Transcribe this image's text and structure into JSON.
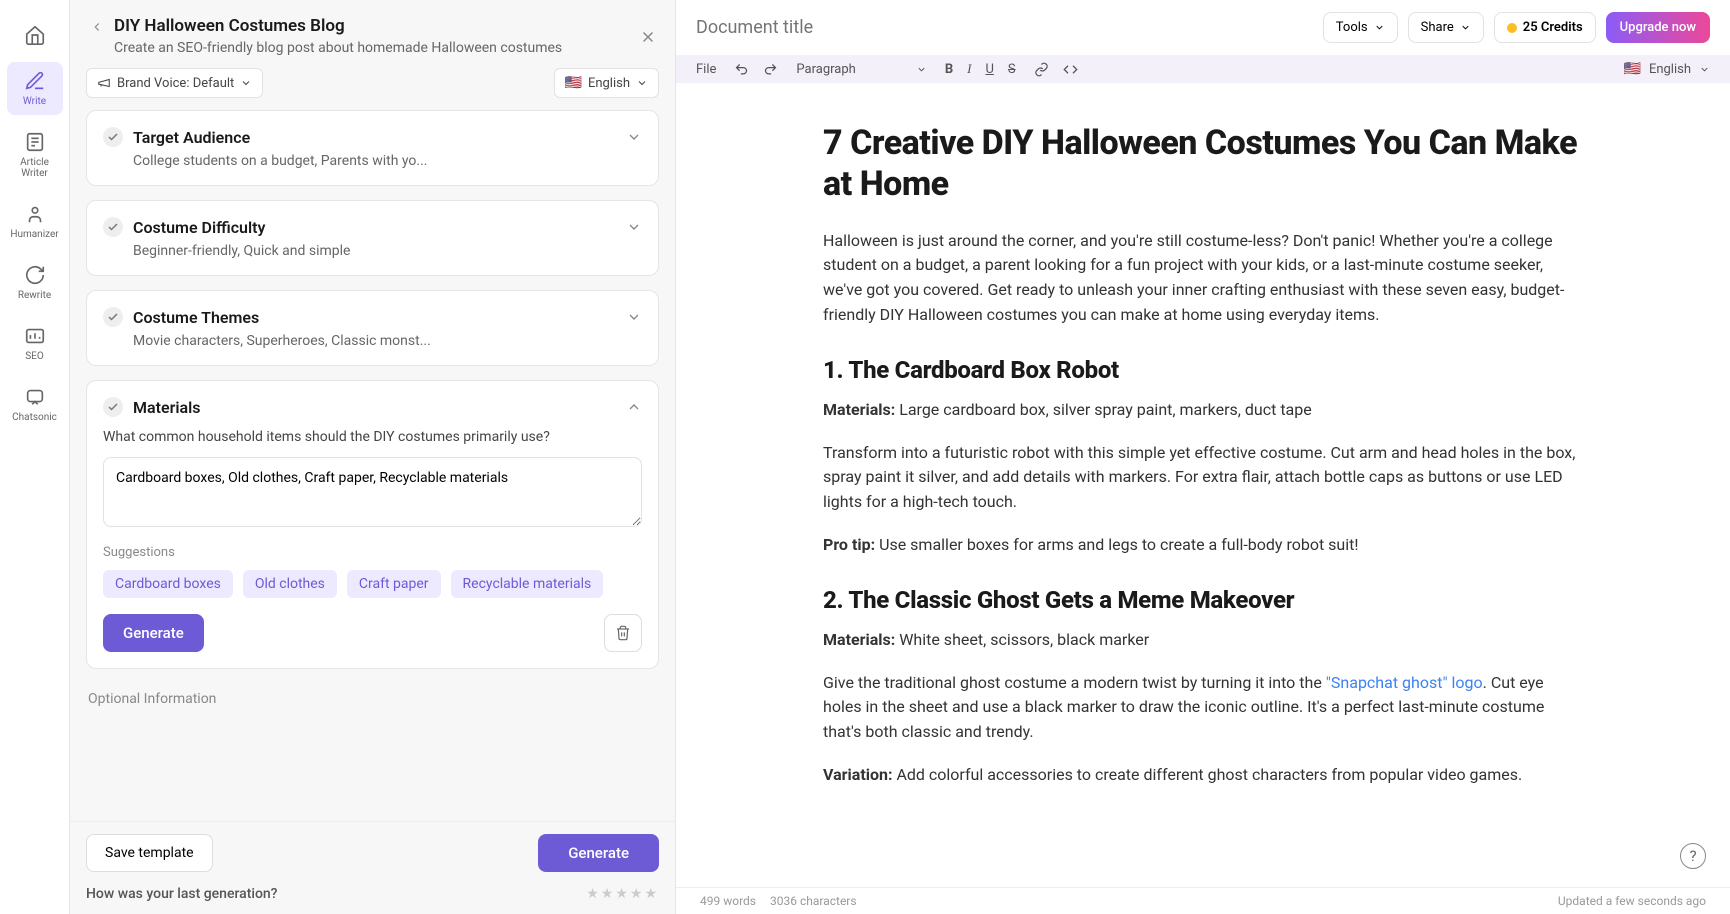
{
  "sidebar": {
    "items": [
      {
        "label": "",
        "icon": "home"
      },
      {
        "label": "Write",
        "icon": "write"
      },
      {
        "label": "Article Writer",
        "icon": "article"
      },
      {
        "label": "Humanizer",
        "icon": "humanizer"
      },
      {
        "label": "Rewrite",
        "icon": "rewrite"
      },
      {
        "label": "SEO",
        "icon": "seo"
      },
      {
        "label": "Chatsonic",
        "icon": "chat"
      }
    ]
  },
  "leftPanel": {
    "title": "DIY Halloween Costumes Blog",
    "subtitle": "Create an SEO-friendly blog post about homemade Halloween costumes",
    "brandVoice": "Brand Voice: Default",
    "language": "English",
    "sections": {
      "audience": {
        "title": "Target Audience",
        "summary": "College students on a budget, Parents with yo..."
      },
      "difficulty": {
        "title": "Costume Difficulty",
        "summary": "Beginner-friendly, Quick and simple"
      },
      "themes": {
        "title": "Costume Themes",
        "summary": "Movie characters, Superheroes, Classic monst..."
      },
      "materials": {
        "title": "Materials",
        "question": "What common household items should the DIY costumes primarily use?",
        "value": "Cardboard boxes, Old clothes, Craft paper, Recyclable materials",
        "suggestionsLabel": "Suggestions",
        "suggestions": [
          "Cardboard boxes",
          "Old clothes",
          "Craft paper",
          "Recyclable materials"
        ],
        "generateLabel": "Generate"
      }
    },
    "optionalLabel": "Optional Information",
    "saveTemplateLabel": "Save template",
    "generateLabel": "Generate",
    "ratingQuestion": "How was your last generation?"
  },
  "rightPanel": {
    "docTitlePlaceholder": "Document title",
    "toolsLabel": "Tools",
    "shareLabel": "Share",
    "creditsLabel": "25 Credits",
    "upgradeLabel": "Upgrade now",
    "toolbar": {
      "file": "File",
      "paragraph": "Paragraph",
      "language": "English"
    },
    "article": {
      "h1": "7 Creative DIY Halloween Costumes You Can Make at Home",
      "intro": "Halloween is just around the corner, and you're still costume-less? Don't panic! Whether you're a college student on a budget, a parent looking for a fun project with your kids, or a last-minute costume seeker, we've got you covered. Get ready to unleash your inner crafting enthusiast with these seven easy, budget-friendly DIY Halloween costumes you can make at home using everyday items.",
      "s1": {
        "h": "1. The Cardboard Box Robot",
        "matLabel": "Materials:",
        "mat": " Large cardboard box, silver spray paint, markers, duct tape",
        "body": "Transform into a futuristic robot with this simple yet effective costume. Cut arm and head holes in the box, spray paint it silver, and add details with markers. For extra flair, attach bottle caps as buttons or use LED lights for a high-tech touch.",
        "tipLabel": "Pro tip:",
        "tip": " Use smaller boxes for arms and legs to create a full-body robot suit!"
      },
      "s2": {
        "h": "2. The Classic Ghost Gets a Meme Makeover",
        "matLabel": "Materials:",
        "mat": " White sheet, scissors, black marker",
        "pre": "Give the traditional ghost costume a modern twist by turning it into the ",
        "link": "\"Snapchat ghost\" logo",
        "post": ". Cut eye holes in the sheet and use a black marker to draw the iconic outline. It's a perfect last-minute costume that's both classic and trendy.",
        "varLabel": "Variation:",
        "var": " Add colorful accessories to create different ghost characters from popular video games."
      }
    },
    "footer": {
      "words": "499 words",
      "chars": "3036 characters",
      "updated": "Updated a few seconds ago"
    }
  }
}
